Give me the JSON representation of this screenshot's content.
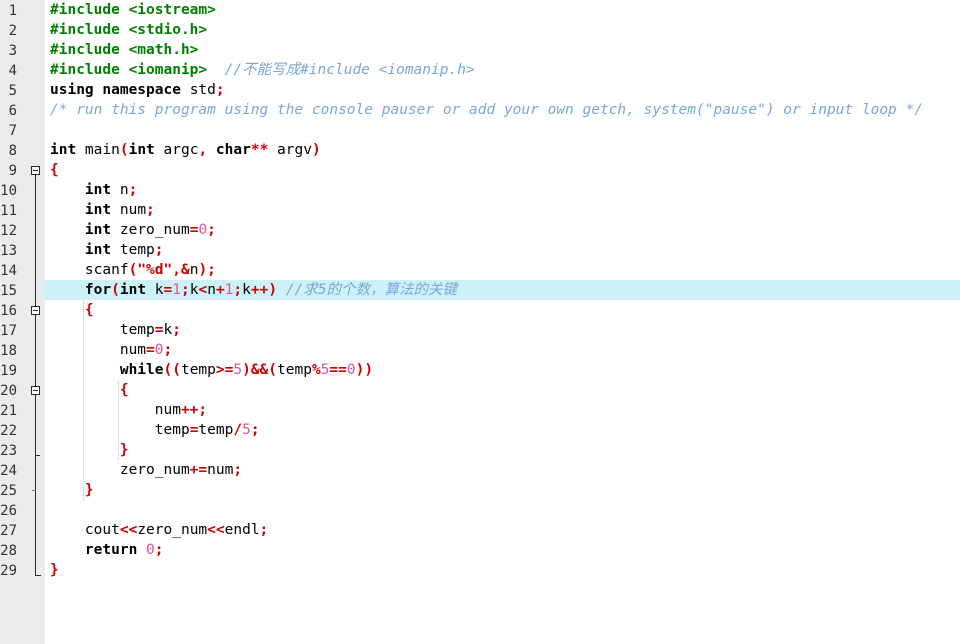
{
  "app": {
    "type": "code-editor",
    "language": "C++",
    "theme": "light",
    "colors": {
      "background": "#ffffff",
      "gutter_background": "#ebebeb",
      "gutter_text": "#333333",
      "keyword": "#000000",
      "preprocessor": "#008000",
      "comment": "#7aa7d8",
      "punctuation": "#cc0000",
      "string": "#cc0000",
      "number": "#e0529c",
      "identifier": "#000000",
      "current_line_highlight": "#ccf2f7"
    },
    "current_line": 15,
    "total_lines": 29
  },
  "gutter": {
    "numbers": [
      "1",
      "2",
      "3",
      "4",
      "5",
      "6",
      "7",
      "8",
      "9",
      "10",
      "11",
      "12",
      "13",
      "14",
      "15",
      "16",
      "17",
      "18",
      "19",
      "20",
      "21",
      "22",
      "23",
      "24",
      "25",
      "26",
      "27",
      "28",
      "29"
    ],
    "fold_markers": [
      {
        "line": 9,
        "kind": "collapse-box"
      },
      {
        "line": 16,
        "kind": "collapse-box"
      },
      {
        "line": 20,
        "kind": "collapse-box"
      },
      {
        "line": 23,
        "kind": "block-end-tick"
      },
      {
        "line": 25,
        "kind": "block-end-tick"
      },
      {
        "line": 29,
        "kind": "block-end-corner"
      }
    ]
  },
  "code": {
    "lines": [
      {
        "n": 1,
        "text": "#include <iostream>",
        "tokens": [
          {
            "t": "#include <iostream>",
            "c": "pp"
          }
        ]
      },
      {
        "n": 2,
        "text": "#include <stdio.h>",
        "tokens": [
          {
            "t": "#include <stdio.h>",
            "c": "pp"
          }
        ]
      },
      {
        "n": 3,
        "text": "#include <math.h>",
        "tokens": [
          {
            "t": "#include <math.h>",
            "c": "pp"
          }
        ]
      },
      {
        "n": 4,
        "text": "#include <iomanip>  //不能写成#include <iomanip.h>",
        "tokens": [
          {
            "t": "#include <iomanip>",
            "c": "pp"
          },
          {
            "t": "  ",
            "c": "id"
          },
          {
            "t": "//不能写成#include <iomanip.h>",
            "c": "cm"
          }
        ]
      },
      {
        "n": 5,
        "text": "using namespace std;",
        "tokens": [
          {
            "t": "using",
            "c": "kw"
          },
          {
            "t": " ",
            "c": "id"
          },
          {
            "t": "namespace",
            "c": "kw"
          },
          {
            "t": " std",
            "c": "id"
          },
          {
            "t": ";",
            "c": "pun"
          }
        ]
      },
      {
        "n": 6,
        "text": "/* run this program using the console pauser or add your own getch, system(\"pause\") or input loop */",
        "tokens": [
          {
            "t": "/* run this program using the console pauser or add your own getch, system(\"pause\") or input loop */",
            "c": "cm"
          }
        ]
      },
      {
        "n": 7,
        "text": "",
        "tokens": []
      },
      {
        "n": 8,
        "text": "int main(int argc, char** argv)",
        "tokens": [
          {
            "t": "int",
            "c": "kw"
          },
          {
            "t": " main",
            "c": "id"
          },
          {
            "t": "(",
            "c": "pun"
          },
          {
            "t": "int",
            "c": "kw"
          },
          {
            "t": " argc",
            "c": "id"
          },
          {
            "t": ",",
            "c": "pun"
          },
          {
            "t": " ",
            "c": "id"
          },
          {
            "t": "char",
            "c": "kw"
          },
          {
            "t": "**",
            "c": "pun"
          },
          {
            "t": " argv",
            "c": "id"
          },
          {
            "t": ")",
            "c": "pun"
          }
        ]
      },
      {
        "n": 9,
        "text": "{",
        "tokens": [
          {
            "t": "{",
            "c": "pun"
          }
        ]
      },
      {
        "n": 10,
        "text": "    int n;",
        "tokens": [
          {
            "t": "    ",
            "c": "id"
          },
          {
            "t": "int",
            "c": "kw"
          },
          {
            "t": " n",
            "c": "id"
          },
          {
            "t": ";",
            "c": "pun"
          }
        ]
      },
      {
        "n": 11,
        "text": "    int num;",
        "tokens": [
          {
            "t": "    ",
            "c": "id"
          },
          {
            "t": "int",
            "c": "kw"
          },
          {
            "t": " num",
            "c": "id"
          },
          {
            "t": ";",
            "c": "pun"
          }
        ]
      },
      {
        "n": 12,
        "text": "    int zero_num=0;",
        "tokens": [
          {
            "t": "    ",
            "c": "id"
          },
          {
            "t": "int",
            "c": "kw"
          },
          {
            "t": " zero_num",
            "c": "id"
          },
          {
            "t": "=",
            "c": "pun"
          },
          {
            "t": "0",
            "c": "num"
          },
          {
            "t": ";",
            "c": "pun"
          }
        ]
      },
      {
        "n": 13,
        "text": "    int temp;",
        "tokens": [
          {
            "t": "    ",
            "c": "id"
          },
          {
            "t": "int",
            "c": "kw"
          },
          {
            "t": " temp",
            "c": "id"
          },
          {
            "t": ";",
            "c": "pun"
          }
        ]
      },
      {
        "n": 14,
        "text": "    scanf(\"%d\",&n);",
        "tokens": [
          {
            "t": "    scanf",
            "c": "id"
          },
          {
            "t": "(",
            "c": "pun"
          },
          {
            "t": "\"%d\"",
            "c": "str"
          },
          {
            "t": ",&",
            "c": "pun"
          },
          {
            "t": "n",
            "c": "id"
          },
          {
            "t": ")",
            "c": "pun"
          },
          {
            "t": ";",
            "c": "pun"
          }
        ]
      },
      {
        "n": 15,
        "text": "    for(int k=1;k<n+1;k++) //求5的个数，算法的关键",
        "highlighted": true,
        "tokens": [
          {
            "t": "    ",
            "c": "id"
          },
          {
            "t": "for",
            "c": "kw"
          },
          {
            "t": "(",
            "c": "pun"
          },
          {
            "t": "int",
            "c": "kw"
          },
          {
            "t": " k",
            "c": "id"
          },
          {
            "t": "=",
            "c": "pun"
          },
          {
            "t": "1",
            "c": "num"
          },
          {
            "t": ";",
            "c": "pun"
          },
          {
            "t": "k",
            "c": "id"
          },
          {
            "t": "<",
            "c": "pun"
          },
          {
            "t": "n",
            "c": "id"
          },
          {
            "t": "+",
            "c": "pun"
          },
          {
            "t": "1",
            "c": "num"
          },
          {
            "t": ";",
            "c": "pun"
          },
          {
            "t": "k",
            "c": "id"
          },
          {
            "t": "++)",
            "c": "pun"
          },
          {
            "t": " ",
            "c": "id"
          },
          {
            "t": "//求5的个数，算法的关键",
            "c": "cm"
          }
        ]
      },
      {
        "n": 16,
        "text": "    {",
        "tokens": [
          {
            "t": "    ",
            "c": "id"
          },
          {
            "t": "{",
            "c": "pun"
          }
        ]
      },
      {
        "n": 17,
        "text": "        temp=k;",
        "tokens": [
          {
            "t": "        temp",
            "c": "id"
          },
          {
            "t": "=",
            "c": "pun"
          },
          {
            "t": "k",
            "c": "id"
          },
          {
            "t": ";",
            "c": "pun"
          }
        ]
      },
      {
        "n": 18,
        "text": "        num=0;",
        "tokens": [
          {
            "t": "        num",
            "c": "id"
          },
          {
            "t": "=",
            "c": "pun"
          },
          {
            "t": "0",
            "c": "num"
          },
          {
            "t": ";",
            "c": "pun"
          }
        ]
      },
      {
        "n": 19,
        "text": "        while((temp>=5)&&(temp%5==0))",
        "tokens": [
          {
            "t": "        ",
            "c": "id"
          },
          {
            "t": "while",
            "c": "kw"
          },
          {
            "t": "((",
            "c": "pun"
          },
          {
            "t": "temp",
            "c": "id"
          },
          {
            "t": ">=",
            "c": "pun"
          },
          {
            "t": "5",
            "c": "num"
          },
          {
            "t": ")&&(",
            "c": "pun"
          },
          {
            "t": "temp",
            "c": "id"
          },
          {
            "t": "%",
            "c": "pun"
          },
          {
            "t": "5",
            "c": "num"
          },
          {
            "t": "==",
            "c": "pun"
          },
          {
            "t": "0",
            "c": "num"
          },
          {
            "t": "))",
            "c": "pun"
          }
        ]
      },
      {
        "n": 20,
        "text": "        {",
        "tokens": [
          {
            "t": "        ",
            "c": "id"
          },
          {
            "t": "{",
            "c": "pun"
          }
        ]
      },
      {
        "n": 21,
        "text": "            num++;",
        "tokens": [
          {
            "t": "            num",
            "c": "id"
          },
          {
            "t": "++",
            "c": "pun"
          },
          {
            "t": ";",
            "c": "pun"
          }
        ]
      },
      {
        "n": 22,
        "text": "            temp=temp/5;",
        "tokens": [
          {
            "t": "            temp",
            "c": "id"
          },
          {
            "t": "=",
            "c": "pun"
          },
          {
            "t": "temp",
            "c": "id"
          },
          {
            "t": "/",
            "c": "pun"
          },
          {
            "t": "5",
            "c": "num"
          },
          {
            "t": ";",
            "c": "pun"
          }
        ]
      },
      {
        "n": 23,
        "text": "        }",
        "tokens": [
          {
            "t": "        ",
            "c": "id"
          },
          {
            "t": "}",
            "c": "pun"
          }
        ]
      },
      {
        "n": 24,
        "text": "        zero_num+=num;",
        "tokens": [
          {
            "t": "        zero_num",
            "c": "id"
          },
          {
            "t": "+=",
            "c": "pun"
          },
          {
            "t": "num",
            "c": "id"
          },
          {
            "t": ";",
            "c": "pun"
          }
        ]
      },
      {
        "n": 25,
        "text": "    }",
        "tokens": [
          {
            "t": "    ",
            "c": "id"
          },
          {
            "t": "}",
            "c": "pun"
          }
        ]
      },
      {
        "n": 26,
        "text": "",
        "tokens": []
      },
      {
        "n": 27,
        "text": "    cout<<zero_num<<endl;",
        "tokens": [
          {
            "t": "    cout",
            "c": "id"
          },
          {
            "t": "<<",
            "c": "pun"
          },
          {
            "t": "zero_num",
            "c": "id"
          },
          {
            "t": "<<",
            "c": "pun"
          },
          {
            "t": "endl",
            "c": "id"
          },
          {
            "t": ";",
            "c": "pun"
          }
        ]
      },
      {
        "n": 28,
        "text": "    return 0;",
        "tokens": [
          {
            "t": "    ",
            "c": "id"
          },
          {
            "t": "return",
            "c": "kw"
          },
          {
            "t": " ",
            "c": "id"
          },
          {
            "t": "0",
            "c": "num"
          },
          {
            "t": ";",
            "c": "pun"
          }
        ]
      },
      {
        "n": 29,
        "text": "}",
        "tokens": [
          {
            "t": "}",
            "c": "pun"
          }
        ]
      }
    ]
  }
}
